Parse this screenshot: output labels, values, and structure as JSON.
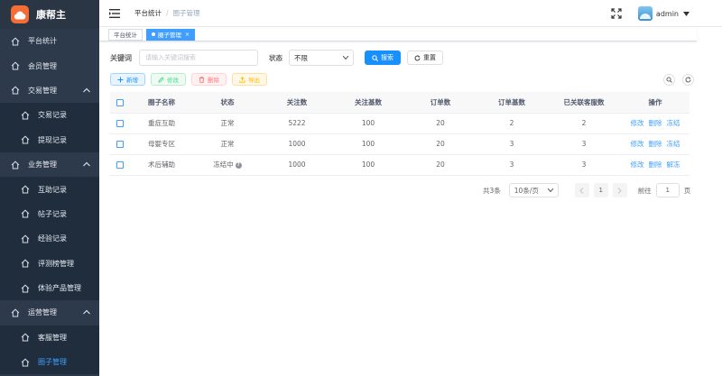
{
  "brand": {
    "name": "康帮主"
  },
  "sidebar": {
    "items": [
      {
        "label": "平台统计",
        "icon": "home-icon",
        "type": "top"
      },
      {
        "label": "会员管理",
        "icon": "home-icon",
        "type": "top"
      },
      {
        "label": "交易管理",
        "icon": "home-icon",
        "type": "group",
        "expanded": true
      },
      {
        "label": "交易记录",
        "icon": "home-icon",
        "type": "sub"
      },
      {
        "label": "提现记录",
        "icon": "home-icon",
        "type": "sub"
      },
      {
        "label": "业务管理",
        "icon": "home-icon",
        "type": "group",
        "expanded": true
      },
      {
        "label": "互助记录",
        "icon": "home-icon",
        "type": "sub"
      },
      {
        "label": "帖子记录",
        "icon": "home-icon",
        "type": "sub"
      },
      {
        "label": "经验记录",
        "icon": "home-icon",
        "type": "sub"
      },
      {
        "label": "评测榜管理",
        "icon": "home-icon",
        "type": "sub"
      },
      {
        "label": "体验产品管理",
        "icon": "home-icon",
        "type": "sub"
      },
      {
        "label": "运营管理",
        "icon": "home-icon",
        "type": "group",
        "expanded": true
      },
      {
        "label": "客服管理",
        "icon": "home-icon",
        "type": "sub"
      },
      {
        "label": "圈子管理",
        "icon": "home-icon",
        "type": "sub",
        "active": true
      }
    ]
  },
  "header": {
    "breadcrumb_home": "平台统计",
    "breadcrumb_sep": "/",
    "breadcrumb_current": "圈子管理",
    "username": "admin"
  },
  "tags": {
    "tag1": "平台统计",
    "tag2": "圈子管理",
    "close": "×"
  },
  "search": {
    "keyword_label": "关键词",
    "keyword_placeholder": "请输入关键词搜索",
    "status_label": "状态",
    "status_value": "不限",
    "search_button": "搜索",
    "reset_button": "重置"
  },
  "toolbar": {
    "add": "新增",
    "edit": "修改",
    "delete": "删除",
    "export": "导出"
  },
  "table": {
    "headers": [
      "圈子名称",
      "状态",
      "关注数",
      "关注基数",
      "订单数",
      "订单基数",
      "已关联客服数",
      "操作"
    ],
    "rows": [
      {
        "name": "重症互助",
        "status": "正常",
        "follows": "5222",
        "follow_base": "100",
        "orders": "20",
        "order_base": "2",
        "cs": "2",
        "op1": "修改",
        "op2": "删除",
        "op3": "冻结"
      },
      {
        "name": "母婴专区",
        "status": "正常",
        "follows": "1000",
        "follow_base": "100",
        "orders": "20",
        "order_base": "3",
        "cs": "3",
        "op1": "修改",
        "op2": "删除",
        "op3": "冻结"
      },
      {
        "name": "术后辅助",
        "status": "冻结中",
        "follows": "1000",
        "follow_base": "100",
        "orders": "20",
        "order_base": "3",
        "cs": "3",
        "op1": "修改",
        "op2": "删除",
        "op3": "解冻"
      }
    ],
    "status_help": "?"
  },
  "pagination": {
    "total": "共3条",
    "page_size": "10条/页",
    "current_page": "1",
    "goto_label": "前往",
    "goto_value": "1",
    "page_unit": "页"
  },
  "colors": {
    "sidebar_bg": "#2d3a4b",
    "primary": "#409eff",
    "brand_logo": "#f56c35"
  }
}
